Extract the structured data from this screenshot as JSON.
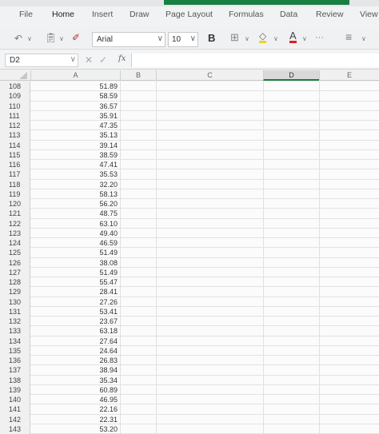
{
  "tabs": [
    "File",
    "Home",
    "Insert",
    "Draw",
    "Page Layout",
    "Formulas",
    "Data",
    "Review",
    "View"
  ],
  "active_tab": "Home",
  "toolbar": {
    "font_name": "Arial",
    "font_size": "10",
    "bold_label": "B",
    "more_label": "···"
  },
  "formula_bar": {
    "name_box": "D2",
    "fx_label": "fx",
    "content": ""
  },
  "columns": [
    "A",
    "B",
    "C",
    "D",
    "E"
  ],
  "selected_column": "D",
  "rows": [
    {
      "num": "108",
      "a": "51.89"
    },
    {
      "num": "109",
      "a": "58.59"
    },
    {
      "num": "110",
      "a": "36.57"
    },
    {
      "num": "111",
      "a": "35.91"
    },
    {
      "num": "112",
      "a": "47.35"
    },
    {
      "num": "113",
      "a": "35.13"
    },
    {
      "num": "114",
      "a": "39.14"
    },
    {
      "num": "115",
      "a": "38.59"
    },
    {
      "num": "116",
      "a": "47.41"
    },
    {
      "num": "117",
      "a": "35.53"
    },
    {
      "num": "118",
      "a": "32.20"
    },
    {
      "num": "119",
      "a": "58.13"
    },
    {
      "num": "120",
      "a": "56.20"
    },
    {
      "num": "121",
      "a": "48.75"
    },
    {
      "num": "122",
      "a": "63.10"
    },
    {
      "num": "123",
      "a": "49.40"
    },
    {
      "num": "124",
      "a": "46.59"
    },
    {
      "num": "125",
      "a": "51.49"
    },
    {
      "num": "126",
      "a": "38.08"
    },
    {
      "num": "127",
      "a": "51.49"
    },
    {
      "num": "128",
      "a": "55.47"
    },
    {
      "num": "129",
      "a": "28.41"
    },
    {
      "num": "130",
      "a": "27.26"
    },
    {
      "num": "131",
      "a": "53.41"
    },
    {
      "num": "132",
      "a": "23.67"
    },
    {
      "num": "133",
      "a": "63.18"
    },
    {
      "num": "134",
      "a": "27.64"
    },
    {
      "num": "135",
      "a": "24.64"
    },
    {
      "num": "136",
      "a": "26.83"
    },
    {
      "num": "137",
      "a": "38.94"
    },
    {
      "num": "138",
      "a": "35.34"
    },
    {
      "num": "139",
      "a": "60.89"
    },
    {
      "num": "140",
      "a": "46.95"
    },
    {
      "num": "141",
      "a": "22.16"
    },
    {
      "num": "142",
      "a": "22.31"
    },
    {
      "num": "143",
      "a": "53.20"
    }
  ],
  "colors": {
    "accent_green": "#1a7f43",
    "font_color_red": "#e02020",
    "highlight_yellow": "#f2d21a"
  }
}
